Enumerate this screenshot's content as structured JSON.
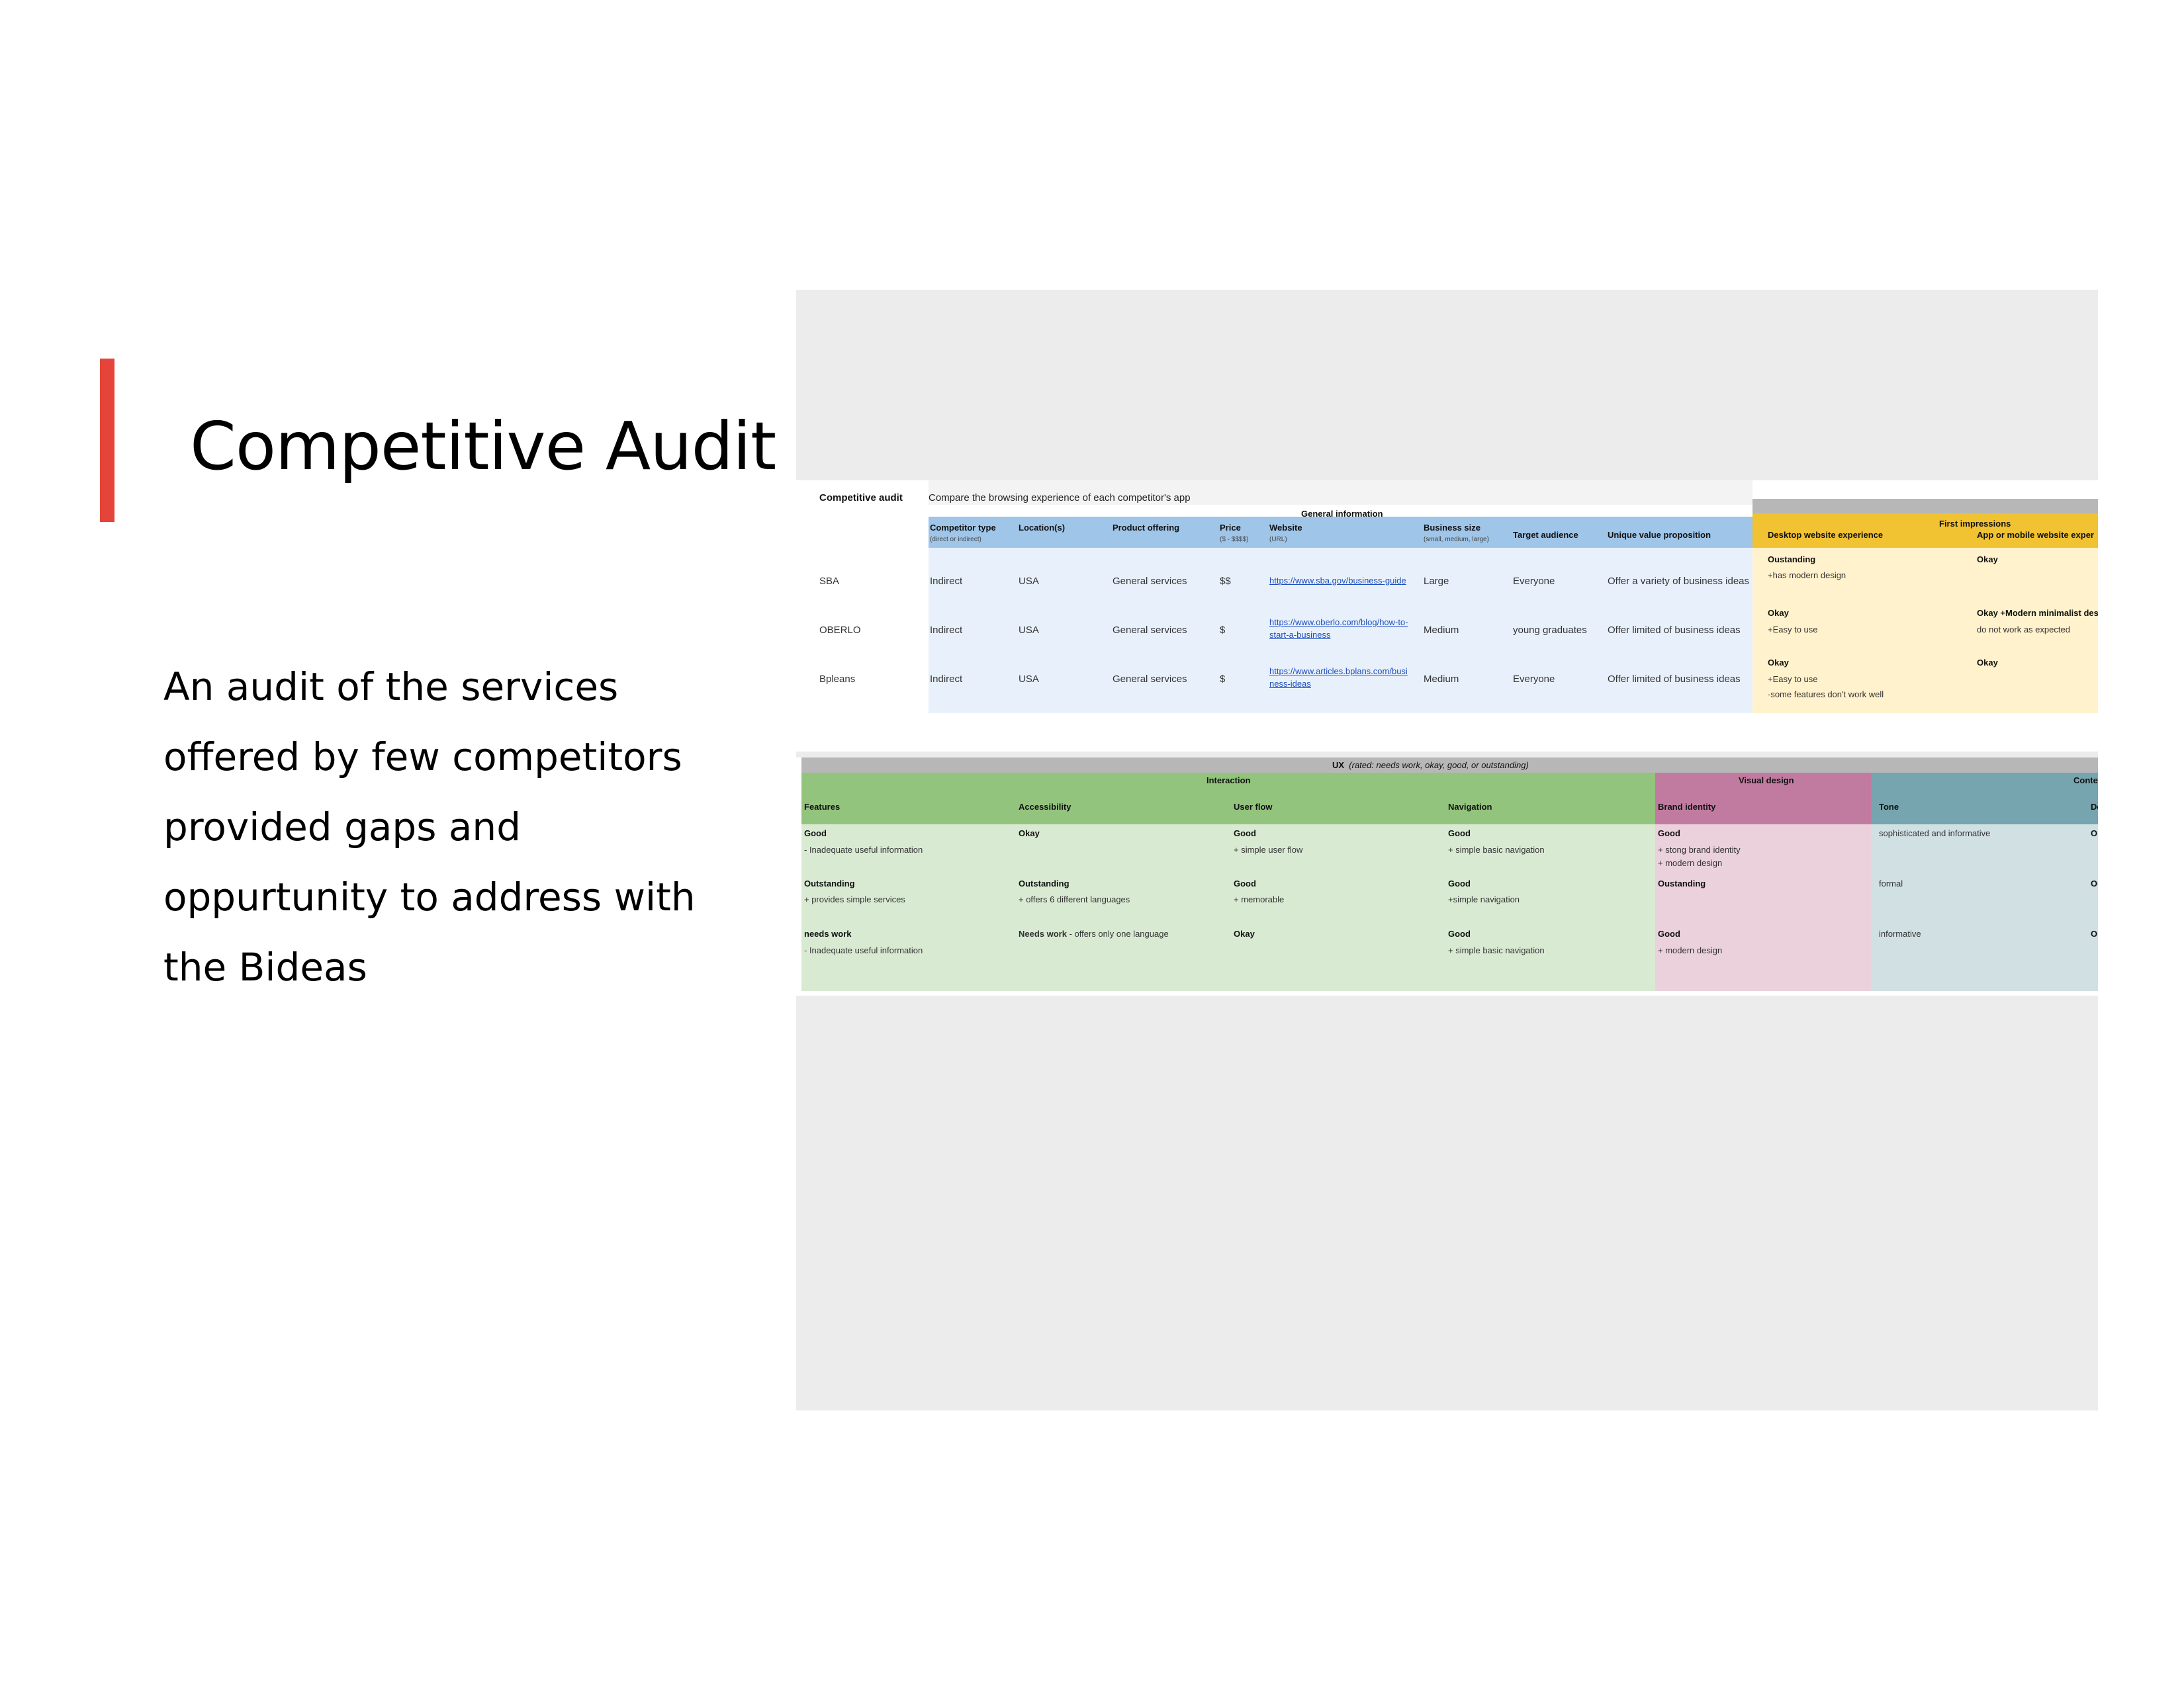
{
  "slide": {
    "title": "Competitive Audit",
    "body_lines": [
      "An audit of the services",
      "offered by few competitors",
      "provided gaps and",
      "oppurtunity to address with",
      "the Bideas"
    ]
  },
  "audit": {
    "label": "Competitive audit",
    "subtitle": "Compare the browsing experience of each competitor's app",
    "general_header": "General information",
    "first_impressions_header": "First impressions",
    "columns": [
      {
        "label": "Competitor type",
        "sub": "(direct or indirect)"
      },
      {
        "label": "Location(s)",
        "sub": ""
      },
      {
        "label": "Product offering",
        "sub": ""
      },
      {
        "label": "Price",
        "sub": "($ - $$$$)"
      },
      {
        "label": "Website",
        "sub": "(URL)"
      },
      {
        "label": "Business size",
        "sub": "(small, medium, large)"
      },
      {
        "label": "Target audience",
        "sub": ""
      },
      {
        "label": "Unique value proposition",
        "sub": ""
      }
    ],
    "fi_columns": [
      "Desktop website experience",
      "App or mobile website exper"
    ],
    "rows": [
      {
        "name": "SBA",
        "type": "Indirect",
        "location": "USA",
        "offering": "General services",
        "price": "$$",
        "website": [
          "https://www.sba.gov/business-guide"
        ],
        "size": "Large",
        "audience": "Everyone",
        "uvp": "Offer a variety of business ideas",
        "desktop": [
          "Oustanding",
          "+has modern design"
        ],
        "app": [
          "Okay",
          ""
        ]
      },
      {
        "name": "OBERLO",
        "type": "Indirect",
        "location": "USA",
        "offering": "General services",
        "price": "$",
        "website": [
          "https://www.oberlo.com/blog/how-to-",
          "start-a-business"
        ],
        "size": "Medium",
        "audience": "young graduates",
        "uvp": "Offer limited of business ideas",
        "desktop": [
          "Okay",
          "+Easy to use"
        ],
        "app": [
          "Okay +Modern minimalist desig",
          "do not work as expected"
        ]
      },
      {
        "name": "Bpleans",
        "type": "Indirect",
        "location": "USA",
        "offering": "General services",
        "price": "$",
        "website": [
          "https://www.articles.bplans.com/busi",
          "ness-ideas"
        ],
        "size": "Medium",
        "audience": "Everyone",
        "uvp": "Offer limited of business ideas",
        "desktop": [
          "Okay",
          "+Easy to use",
          "-some features don't work well"
        ],
        "app": [
          "Okay",
          ""
        ]
      }
    ]
  },
  "ux": {
    "header_bold": "UX",
    "header_note": "(rated: needs work, okay, good, or outstanding)",
    "groups": [
      "Interaction",
      "Visual design",
      "Conter"
    ],
    "columns": [
      "Features",
      "Accessibility",
      "User flow",
      "Navigation",
      "Brand identity",
      "Tone",
      "De"
    ],
    "rows": [
      {
        "features": [
          "Good",
          "- Inadequate useful information"
        ],
        "accessibility": [
          "Okay",
          ""
        ],
        "userflow": [
          "Good",
          "+ simple user flow"
        ],
        "navigation": [
          "Good",
          "+ simple basic navigation"
        ],
        "brand": [
          "Good",
          "+ stong brand identity",
          "+ modern design"
        ],
        "tone": "sophisticated and informative",
        "de": "Ok"
      },
      {
        "features": [
          "Outstanding",
          "+ provides simple services"
        ],
        "accessibility": [
          "Outstanding",
          "+ offers 6 different languages"
        ],
        "userflow": [
          "Good",
          "+ memorable"
        ],
        "navigation": [
          "Good",
          "+simple navigation"
        ],
        "brand": [
          "Oustanding",
          ""
        ],
        "tone": "formal",
        "de": "Ou"
      },
      {
        "features": [
          "needs work",
          "- Inadequate useful information"
        ],
        "accessibility": [
          "Needs work",
          " - offers only one language"
        ],
        "userflow": [
          "Okay",
          ""
        ],
        "navigation": [
          "Good",
          "+ simple basic navigation"
        ],
        "brand": [
          "Good",
          "+ modern design"
        ],
        "tone": "informative",
        "de": "Ok"
      }
    ]
  },
  "colors": {
    "accent": "#e5443a",
    "header_blue": "#9fc5e8",
    "row_blue": "#e8f1fb",
    "header_gold": "#f1c232",
    "row_gold": "#fff2cc",
    "header_green": "#93c47d",
    "row_green": "#d9ead3",
    "header_pink": "#c27ba0",
    "row_pink": "#ead1dc",
    "header_teal": "#76a5af",
    "row_teal": "#d0e0e3",
    "band_gray": "#b7b7b7"
  }
}
